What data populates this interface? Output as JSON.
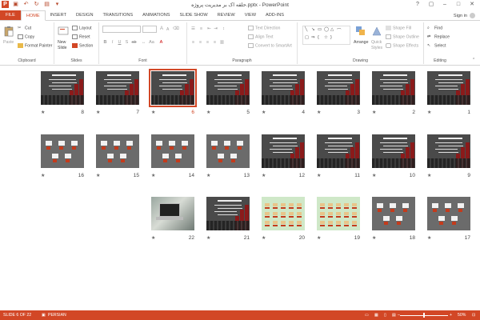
{
  "window": {
    "title": "حلقه اک بر مدیریت پروژه.pptx - PowerPoint",
    "controls": [
      "?",
      "▢",
      "–",
      "□",
      "✕"
    ]
  },
  "quick_access": [
    "save-icon",
    "undo-icon",
    "redo-icon",
    "start-from-beginning-icon"
  ],
  "tabs": [
    {
      "label": "FILE"
    },
    {
      "label": "HOME"
    },
    {
      "label": "INSERT"
    },
    {
      "label": "DESIGN"
    },
    {
      "label": "TRANSITIONS"
    },
    {
      "label": "ANIMATIONS"
    },
    {
      "label": "SLIDE SHOW"
    },
    {
      "label": "REVIEW"
    },
    {
      "label": "VIEW"
    },
    {
      "label": "ADD-INS"
    }
  ],
  "active_tab": "HOME",
  "account": {
    "label": "Sign in"
  },
  "ribbon": {
    "clipboard": {
      "paste": "Paste",
      "cut": "Cut",
      "copy": "Copy",
      "format_painter": "Format Painter",
      "label": "Clipboard"
    },
    "slides": {
      "new_slide": "New",
      "new_slide_2": "Slide",
      "layout": "Layout",
      "reset": "Reset",
      "section": "Section",
      "label": "Slides"
    },
    "font": {
      "label": "Font",
      "size_up": "A",
      "size_down": "A"
    },
    "paragraph": {
      "text_direction": "Text Direction",
      "align_text": "Align Text",
      "convert_smartart": "Convert to SmartArt",
      "label": "Paragraph"
    },
    "drawing": {
      "arrange": "Arrange",
      "quick_styles": "Quick",
      "quick_styles_2": "Styles",
      "shape_fill": "Shape Fill",
      "shape_outline": "Shape Outline",
      "shape_effects": "Shape Effects",
      "label": "Drawing"
    },
    "editing": {
      "find": "Find",
      "replace": "Replace",
      "select": "Select",
      "label": "Editing"
    }
  },
  "slides": [
    {
      "number": "1",
      "style": "dark"
    },
    {
      "number": "2",
      "style": "dark"
    },
    {
      "number": "3",
      "style": "dark"
    },
    {
      "number": "4",
      "style": "dark"
    },
    {
      "number": "5",
      "style": "dark"
    },
    {
      "number": "6",
      "style": "dark",
      "selected": true
    },
    {
      "number": "7",
      "style": "dark"
    },
    {
      "number": "8",
      "style": "dark"
    },
    {
      "number": "9",
      "style": "dark"
    },
    {
      "number": "10",
      "style": "dark"
    },
    {
      "number": "11",
      "style": "dark"
    },
    {
      "number": "12",
      "style": "dark"
    },
    {
      "number": "13",
      "style": "gray"
    },
    {
      "number": "14",
      "style": "gray"
    },
    {
      "number": "15",
      "style": "gray"
    },
    {
      "number": "16",
      "style": "gray"
    },
    {
      "number": "17",
      "style": "gray"
    },
    {
      "number": "18",
      "style": "gray"
    },
    {
      "number": "19",
      "style": "green"
    },
    {
      "number": "20",
      "style": "green"
    },
    {
      "number": "21",
      "style": "dark"
    },
    {
      "number": "22",
      "style": "photo"
    }
  ],
  "star": "★",
  "status": {
    "slide": "SLIDE 6 OF 22",
    "language": "PERSIAN",
    "zoom": "50%",
    "zoom_minus": "–",
    "zoom_plus": "+",
    "zoom_fraction": 0.5
  }
}
